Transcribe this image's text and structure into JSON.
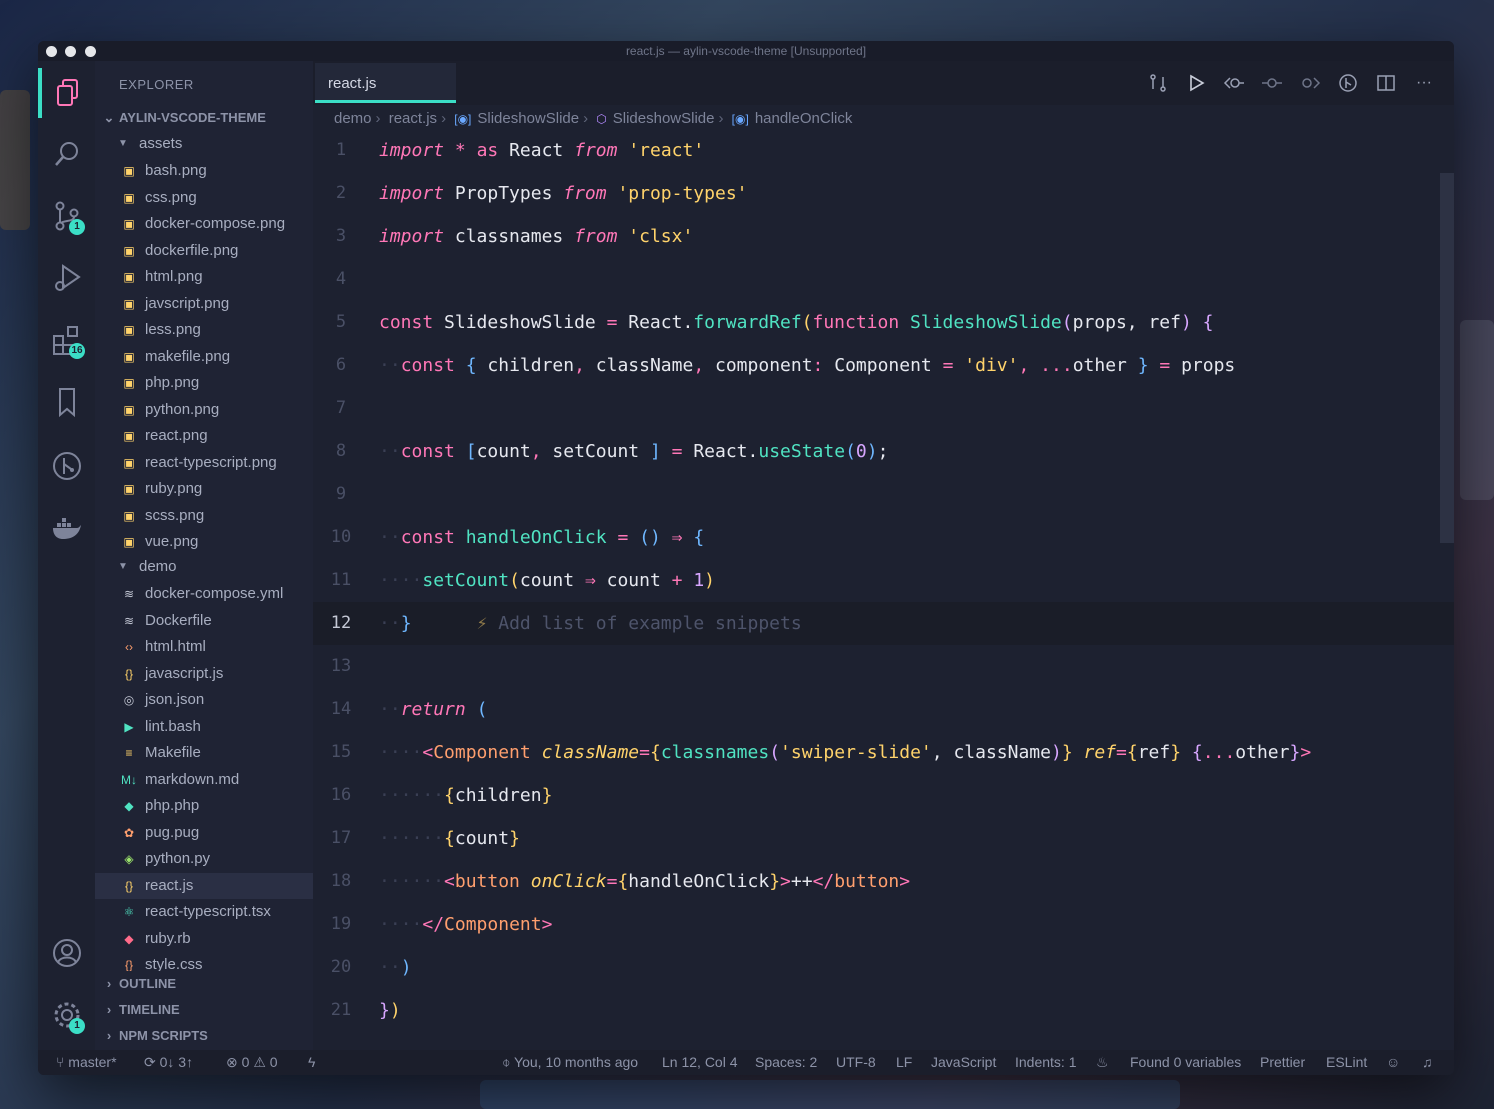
{
  "window": {
    "title": "react.js — aylin-vscode-theme [Unsupported]"
  },
  "activity_bar": {
    "source_control_badge": "1",
    "extensions_badge": "16",
    "settings_badge": "1"
  },
  "sidebar": {
    "title": "EXPLORER",
    "root": "AYLIN-VSCODE-THEME",
    "folders": {
      "assets": "assets",
      "demo": "demo"
    },
    "assets_files": [
      "bash.png",
      "css.png",
      "docker-compose.png",
      "dockerfile.png",
      "html.png",
      "javscript.png",
      "less.png",
      "makefile.png",
      "php.png",
      "python.png",
      "react.png",
      "react-typescript.png",
      "ruby.png",
      "scss.png",
      "vue.png"
    ],
    "demo_files": [
      "docker-compose.yml",
      "Dockerfile",
      "html.html",
      "javascript.js",
      "json.json",
      "lint.bash",
      "Makefile",
      "markdown.md",
      "php.php",
      "pug.pug",
      "python.py",
      "react.js",
      "react-typescript.tsx",
      "ruby.rb",
      "style.css"
    ],
    "sections": [
      "OUTLINE",
      "TIMELINE",
      "NPM SCRIPTS"
    ]
  },
  "tab": {
    "label": "react.js"
  },
  "breadcrumb": {
    "items": [
      "demo",
      "react.js",
      "SlideshowSlide",
      "SlideshowSlide",
      "handleOnClick"
    ]
  },
  "editor": {
    "line_numbers": [
      "1",
      "2",
      "3",
      "4",
      "5",
      "6",
      "7",
      "8",
      "9",
      "10",
      "11",
      "12",
      "13",
      "14",
      "15",
      "16",
      "17",
      "18",
      "19",
      "20",
      "21"
    ],
    "current_line": "12",
    "codelens": "Add list of example snippets"
  },
  "status": {
    "branch": "master*",
    "sync": "0↓ 3↑",
    "errors": "0",
    "warnings": "0",
    "blame": "You, 10 months ago",
    "position": "Ln 12, Col 4",
    "spaces": "Spaces: 2",
    "encoding": "UTF-8",
    "eol": "LF",
    "language": "JavaScript",
    "indents": "Indents: 1",
    "variables": "Found 0 variables",
    "prettier": "Prettier",
    "eslint": "ESLint"
  },
  "colors": {
    "accent": "#3bdec6",
    "keyword": "#ff77b7",
    "string": "#ffd36b",
    "function": "#50e3c2"
  }
}
